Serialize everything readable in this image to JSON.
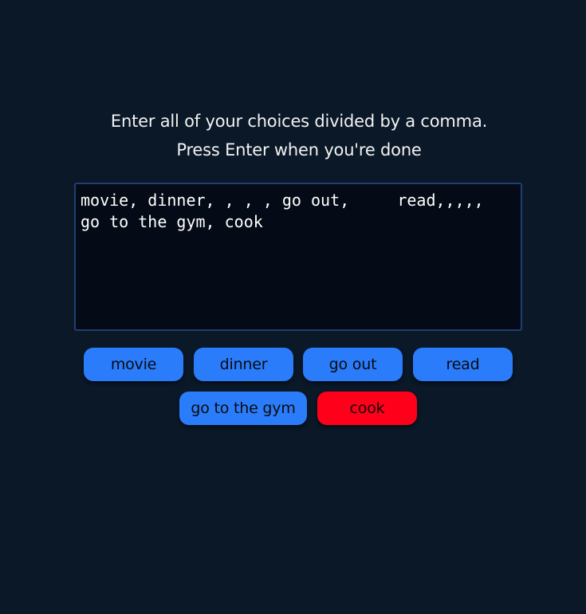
{
  "instructions": {
    "line1": "Enter all of your choices divided by a comma.",
    "line2": "Press Enter when you're done"
  },
  "input": {
    "value": "movie, dinner, , , , go out,     read,,,,,\ngo to the gym, cook"
  },
  "colors": {
    "background": "#0a1827",
    "choice_default": "#2a7cfb",
    "choice_highlight": "#ff001b"
  },
  "choices": [
    {
      "label": "movie",
      "highlighted": false
    },
    {
      "label": "dinner",
      "highlighted": false
    },
    {
      "label": "go out",
      "highlighted": false
    },
    {
      "label": "read",
      "highlighted": false
    },
    {
      "label": "go to the gym",
      "highlighted": false
    },
    {
      "label": "cook",
      "highlighted": true
    }
  ]
}
